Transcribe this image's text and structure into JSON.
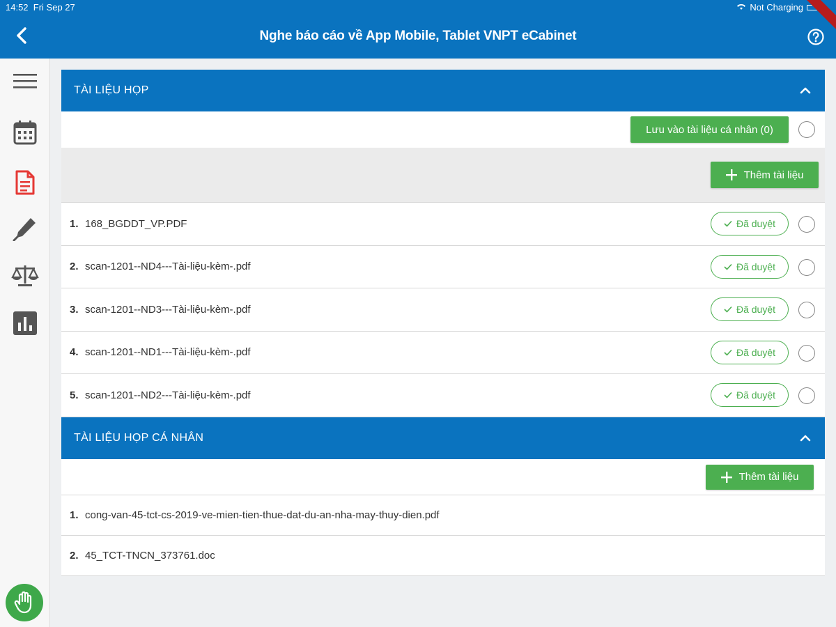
{
  "status_bar": {
    "time": "14:52",
    "date": "Fri Sep 27",
    "charging": "Not Charging"
  },
  "header": {
    "title": "Nghe báo cáo về App Mobile, Tablet VNPT eCabinet"
  },
  "sidebar": {
    "items": [
      {
        "icon": "menu-icon"
      },
      {
        "icon": "calendar-icon"
      },
      {
        "icon": "document-icon",
        "active": true,
        "color": "#e53935"
      },
      {
        "icon": "pen-icon"
      },
      {
        "icon": "scale-icon"
      },
      {
        "icon": "chart-icon"
      }
    ],
    "hand_button": {
      "icon": "raise-hand-icon",
      "color": "#3ea84a"
    }
  },
  "meeting_docs": {
    "title": "TÀI LIỆU HỌP",
    "save_button": "Lưu vào tài liệu cá nhân (0)",
    "add_button": "Thêm tài liệu",
    "approved_label": "Đã duyệt",
    "documents": [
      {
        "index": "1.",
        "name": "168_BGDDT_VP.PDF"
      },
      {
        "index": "2.",
        "name": "scan-1201--ND4---Tài-liệu-kèm-.pdf"
      },
      {
        "index": "3.",
        "name": "scan-1201--ND3---Tài-liệu-kèm-.pdf"
      },
      {
        "index": "4.",
        "name": "scan-1201--ND1---Tài-liệu-kèm-.pdf"
      },
      {
        "index": "5.",
        "name": "scan-1201--ND2---Tài-liệu-kèm-.pdf"
      }
    ]
  },
  "personal_docs": {
    "title": "TÀI LIỆU HỌP CÁ NHÂN",
    "add_button": "Thêm tài liệu",
    "documents": [
      {
        "index": "1.",
        "name": "cong-van-45-tct-cs-2019-ve-mien-tien-thue-dat-du-an-nha-may-thuy-dien.pdf"
      },
      {
        "index": "2.",
        "name": "45_TCT-TNCN_373761.doc"
      }
    ]
  },
  "colors": {
    "primary": "#0a73bf",
    "success": "#4caf50",
    "active_icon": "#e53935"
  }
}
